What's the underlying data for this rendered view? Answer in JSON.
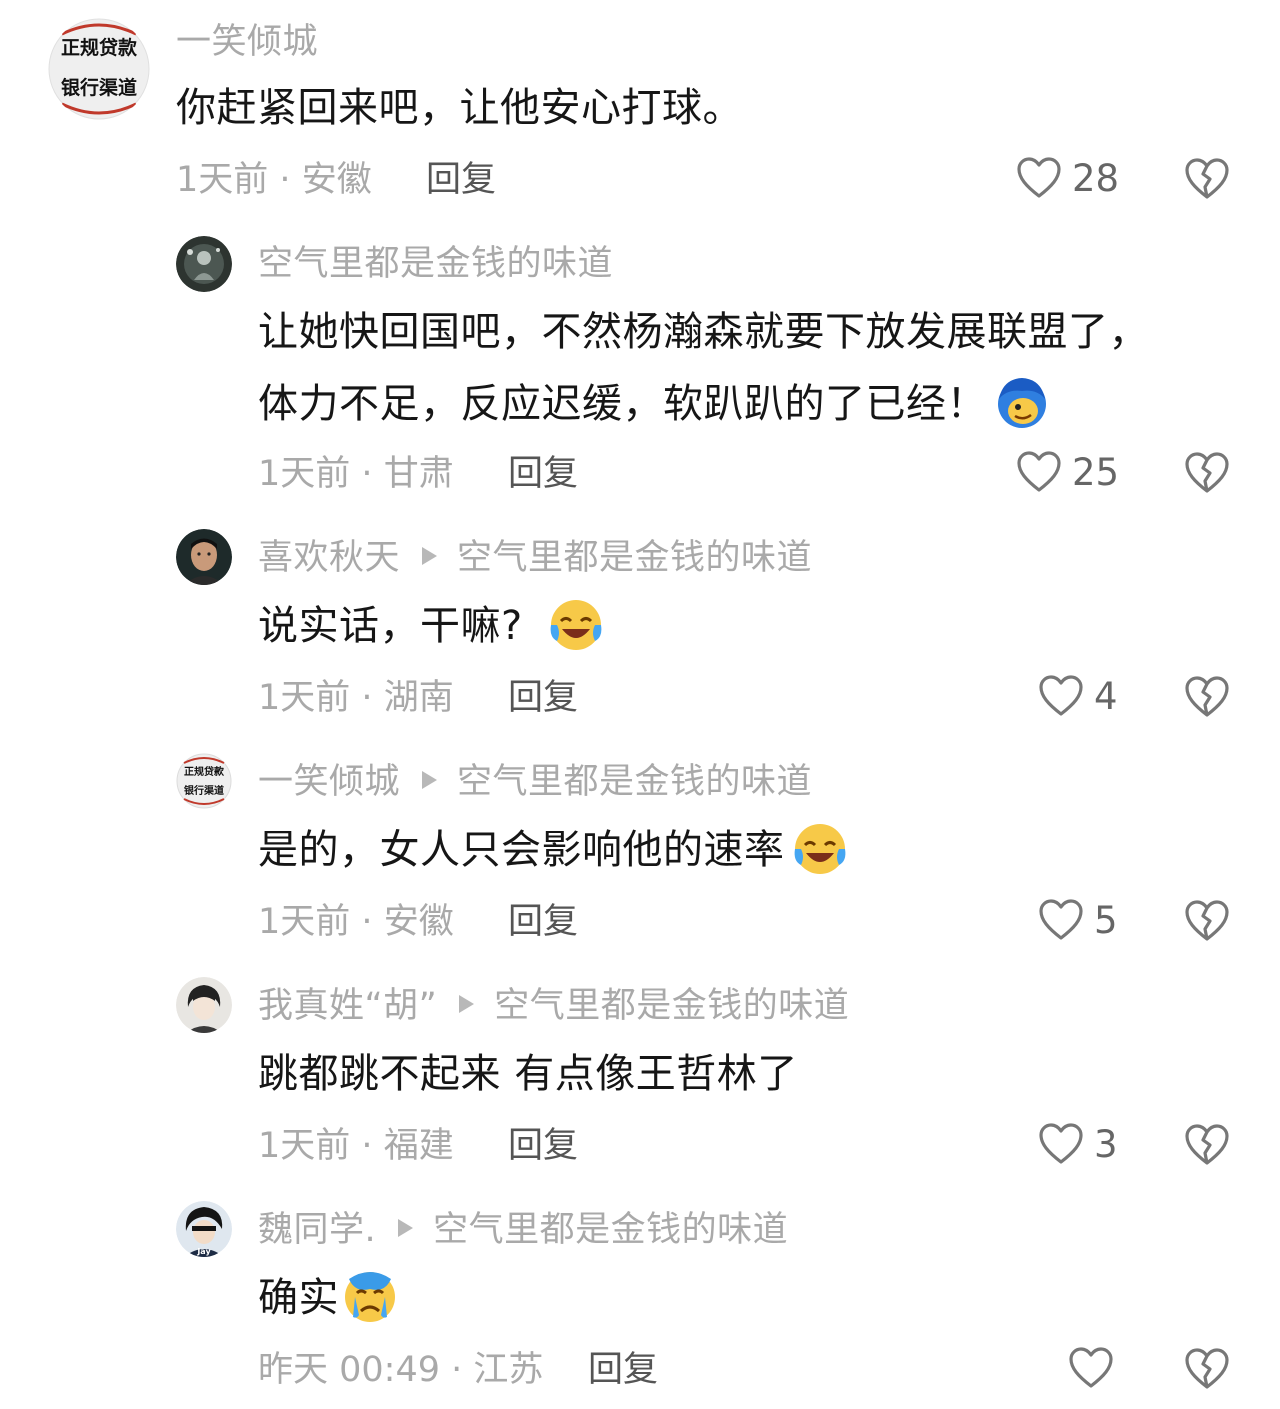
{
  "comments": [
    {
      "user": "一笑倾城",
      "text": "你赶紧回来吧，让他安心打球。",
      "time": "1天前",
      "location": "安徽",
      "reply_label": "回复",
      "likes": "28",
      "avatar_text": [
        "正规贷款",
        "银行渠道"
      ],
      "avatar_icon": "text-badge-avatar"
    },
    {
      "user": "空气里都是金钱的味道",
      "text_lines": [
        "让她快回国吧，不然杨瀚森就要下放发展联盟了，",
        "体力不足，反应迟缓，软趴趴的了已经！"
      ],
      "emoji": "blue-hair-face-emoji",
      "time": "1天前",
      "location": "甘肃",
      "reply_label": "回复",
      "likes": "25",
      "avatar_icon": "dark-photo-avatar"
    },
    {
      "user": "喜欢秋天",
      "reply_to": "空气里都是金钱的味道",
      "text": "说实话，干嘛?",
      "emoji": "laugh-cry-emoji",
      "time": "1天前",
      "location": "湖南",
      "reply_label": "回复",
      "likes": "4",
      "avatar_icon": "man-photo-avatar"
    },
    {
      "user": "一笑倾城",
      "reply_to": "空气里都是金钱的味道",
      "text": "是的，女人只会影响他的速率",
      "emoji": "laugh-cry-emoji",
      "time": "1天前",
      "location": "安徽",
      "reply_label": "回复",
      "likes": "5",
      "avatar_text": [
        "正规贷款",
        "银行渠道"
      ],
      "avatar_icon": "text-badge-avatar"
    },
    {
      "user": "我真姓“胡”",
      "reply_to": "空气里都是金钱的味道",
      "text": "跳都跳不起来 有点像王哲林了",
      "time": "1天前",
      "location": "福建",
      "reply_label": "回复",
      "likes": "3",
      "avatar_icon": "anime-boy-avatar"
    },
    {
      "user": "魏同学.",
      "reply_to": "空气里都是金钱的味道",
      "text": "确实",
      "emoji": "crying-emoji",
      "time": "昨天 00:49",
      "location": "江苏",
      "reply_label": "回复",
      "likes": "",
      "avatar_text": [
        "Jay"
      ],
      "avatar_icon": "cartoon-jay-avatar"
    }
  ],
  "separator": "·",
  "icons": {
    "like": "heart-outline-icon",
    "dislike": "broken-heart-icon"
  },
  "colors": {
    "text": "#161616",
    "meta": "#a9a9a9",
    "reply": "#555555"
  }
}
